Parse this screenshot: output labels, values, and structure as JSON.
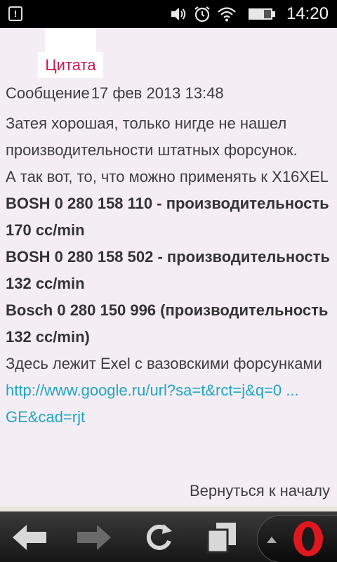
{
  "status_bar": {
    "notification_label": "!",
    "time": "14:20",
    "icons": [
      "notification-icon",
      "volume-icon",
      "alarm-icon",
      "wifi-icon",
      "battery-icon"
    ]
  },
  "quote": {
    "tab_label": "Цитата"
  },
  "message": {
    "header_label": "Сообщение",
    "date": "17 фев 2013 13:48",
    "lines": [
      {
        "text": "Затея хорошая, только нигде не нашел производительности штатных форсунок.",
        "style": "normal"
      },
      {
        "text": "А так вот, то, что можно применять к X16XEL",
        "style": "normal"
      },
      {
        "text": "BOSH 0 280 158 110 - производительность 170 cc/min",
        "style": "bold"
      },
      {
        "text": "BOSH 0 280 158 502 - производительность 132 cc/min",
        "style": "bold"
      },
      {
        "text": "Bosch 0 280 150 996 (производительность 132 cc/min)",
        "style": "bold"
      },
      {
        "text": "Здесь лежит Exel с вазовскими форсунками",
        "style": "normal"
      }
    ],
    "link_text": "http://www.google.ru/url?sa=t&rct=j&q=0  ...  GE&cad=rjt"
  },
  "footer": {
    "back_to_top": "Вернуться к началу"
  },
  "toolbar": {
    "icons": [
      "back-arrow-icon",
      "forward-arrow-icon",
      "reload-icon",
      "tabs-icon",
      "opera-menu-icon"
    ]
  },
  "colors": {
    "background": "#f4eef4",
    "quote_accent": "#c8174e",
    "link": "#1fa5c4",
    "opera_red": "#e0171f"
  }
}
